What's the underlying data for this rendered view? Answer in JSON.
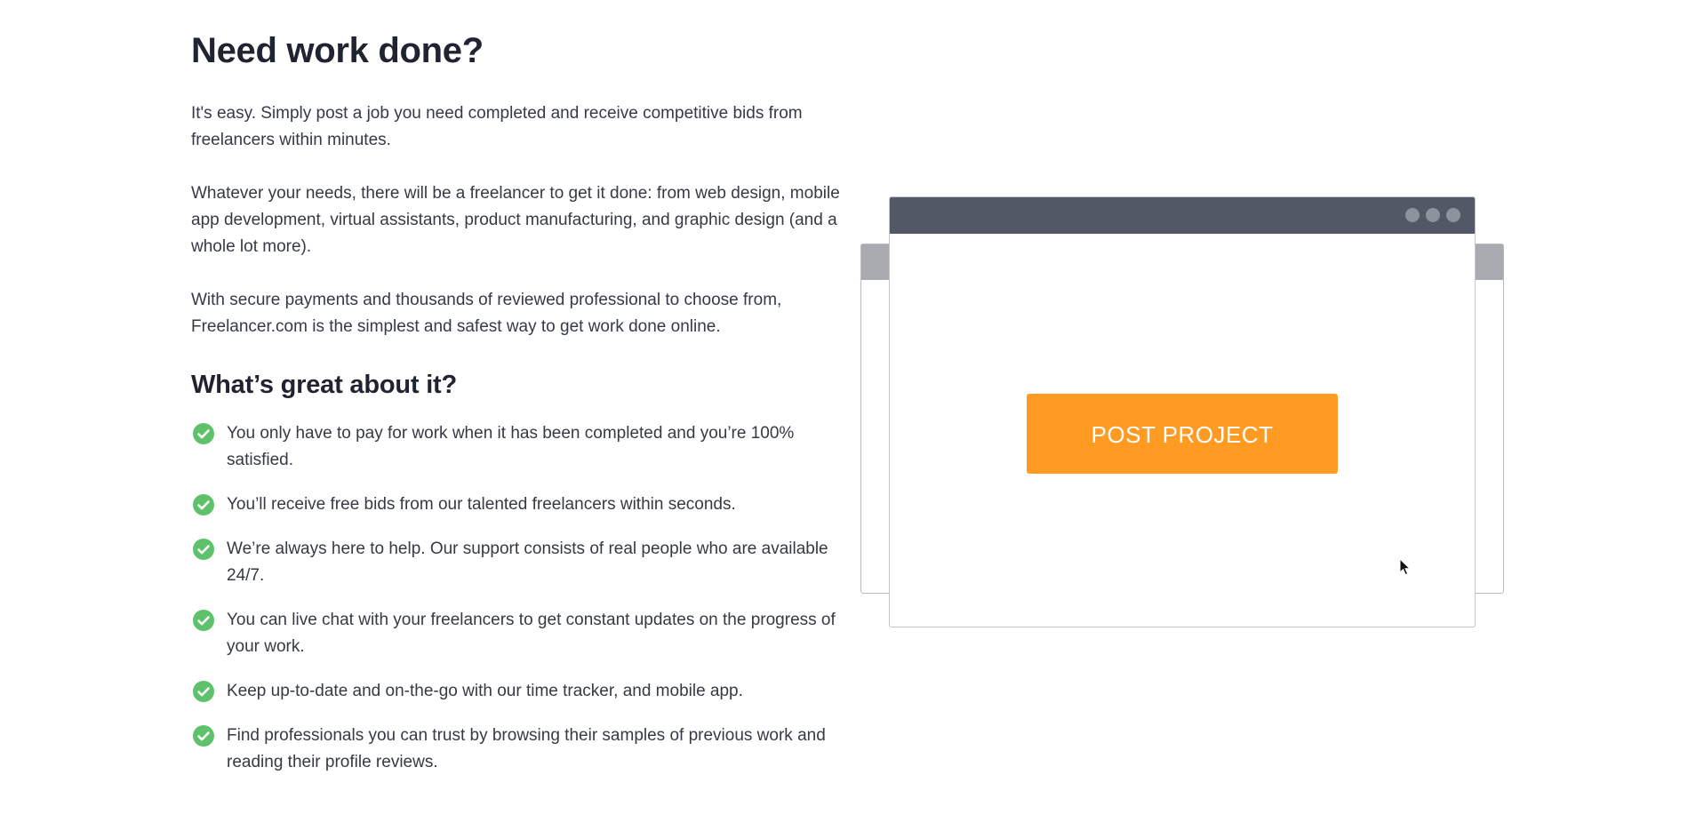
{
  "hero": {
    "title": "Need work done?",
    "paragraphs": [
      "It's easy. Simply post a job you need completed and receive competitive bids from freelancers within minutes.",
      "Whatever your needs, there will be a freelancer to get it done: from web design, mobile app development, virtual assistants, product manufacturing, and graphic design (and a whole lot more).",
      "With secure payments and thousands of reviewed professional to choose from, Freelancer.com is the simplest and safest way to get work done online."
    ]
  },
  "benefits": {
    "title": "What’s great about it?",
    "items": [
      "You only have to pay for work when it has been completed and you’re 100% satisfied.",
      "You’ll receive free bids from our talented freelancers within seconds.",
      "We’re always here to help. Our support consists of real people who are available 24/7.",
      "You can live chat with your freelancers to get constant updates on the progress of your work.",
      "Keep up-to-date and on-the-go with our time tracker, and mobile app.",
      "Find professionals you can trust by browsing their samples of previous work and reading their profile reviews."
    ],
    "check_color": "#5dc26a"
  },
  "illustration": {
    "button_label": "POST PROJECT",
    "button_color": "#ff9a23",
    "titlebar_color": "#525866",
    "back_titlebar_color": "#a9abb1"
  }
}
